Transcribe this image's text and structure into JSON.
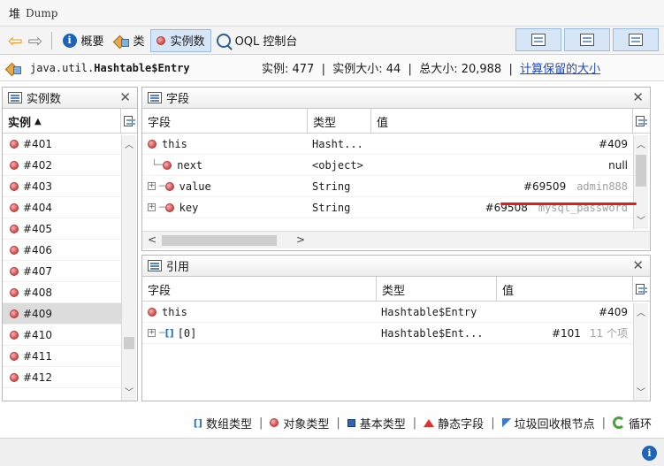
{
  "window": {
    "title": "堆",
    "subtitle": "Dump"
  },
  "toolbar": {
    "back": "⇦",
    "forward": "⇨",
    "summary": "概要",
    "classes": "类",
    "instances": "实例数",
    "oql": "OQL 控制台"
  },
  "infobar": {
    "class_prefix": "java.util.",
    "class_bold": "Hashtable$Entry",
    "stats": "实例: 477  |  实例大小: 44  |  总大小: 20,988  |  ",
    "retained_link": "计算保留的大小"
  },
  "instances_panel": {
    "title": "实例数",
    "column": "实例",
    "sort_arrow": "▲",
    "items": [
      "#401",
      "#402",
      "#403",
      "#404",
      "#405",
      "#406",
      "#407",
      "#408",
      "#409",
      "#410",
      "#411",
      "#412"
    ],
    "selected": "#409"
  },
  "fields_panel": {
    "title": "字段",
    "columns": [
      "字段",
      "类型",
      "值"
    ],
    "rows": [
      {
        "name": "this",
        "type": "Hasht...",
        "value": "#409",
        "extra": ""
      },
      {
        "name": "next",
        "type": "<object>",
        "value": "null",
        "extra": ""
      },
      {
        "name": "value",
        "type": "String",
        "value": "#69509",
        "extra": "admin888"
      },
      {
        "name": "key",
        "type": "String",
        "value": "#69508",
        "extra": "mysql_password"
      }
    ]
  },
  "refs_panel": {
    "title": "引用",
    "columns": [
      "字段",
      "类型",
      "值"
    ],
    "rows": [
      {
        "name": "this",
        "type": "Hashtable$Entry",
        "value": "#409",
        "extra": ""
      },
      {
        "name": "[0]",
        "type": "Hashtable$Ent...",
        "value": "#101",
        "extra": "11 个项"
      }
    ]
  },
  "legend": {
    "array": "数组类型",
    "object": "对象类型",
    "primitive": "基本类型",
    "static": "静态字段",
    "gc_root": "垃圾回收根节点",
    "loop": "循环",
    "separator": "|"
  },
  "colors": {
    "accent": "#1f63b8",
    "highlight": "#e01b1b",
    "link": "#1a49c9"
  }
}
